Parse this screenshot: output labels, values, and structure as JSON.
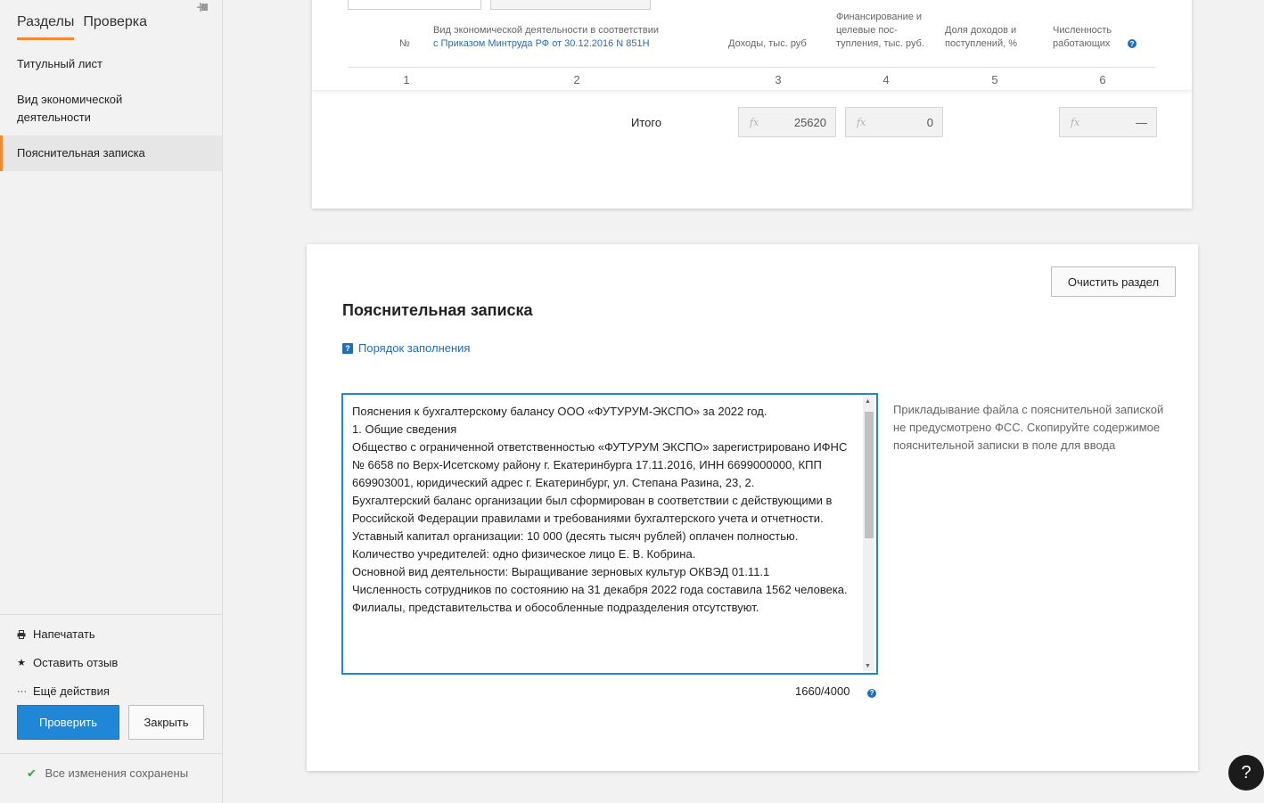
{
  "sidebar": {
    "tabs": [
      {
        "label": "Разделы"
      },
      {
        "label": "Проверка"
      }
    ],
    "items": [
      {
        "label": "Титульный лист"
      },
      {
        "label": "Вид экономической деятельности"
      },
      {
        "label": "Пояснительная записка"
      }
    ],
    "actions": [
      {
        "label": "Напечатать",
        "icon": "printer-icon"
      },
      {
        "label": "Оставить отзыв",
        "icon": "star-icon"
      },
      {
        "label": "Ещё действия",
        "icon": "ellipsis-icon"
      }
    ],
    "check_button": "Проверить",
    "close_button": "Закрыть",
    "saved_status": "Все изменения сохранены"
  },
  "table": {
    "headers": {
      "num": "№",
      "activity_prefix": "Вид экономической деятельности в соответствии",
      "activity_link": "с Приказом Минтруда РФ от 30.12.2016 N 851Н",
      "income": "Доходы, тыс. руб",
      "financing": "Финансирование и целевые пос-тупления, тыс. руб.",
      "share": "Доля доходов и поступлений, %",
      "employees": "Численность работающих"
    },
    "column_numbers": [
      "1",
      "2",
      "3",
      "4",
      "5",
      "6"
    ],
    "total_label": "Итого",
    "totals": {
      "income": "25620",
      "financing": "0",
      "employees": "—"
    },
    "fx_symbol": "fx"
  },
  "note_section": {
    "clear_button": "Очистить раздел",
    "title": "Пояснительная записка",
    "help_link": "Порядок заполнения",
    "text": "Пояснения к бухгалтерскому балансу ООО «ФУТУРУМ-ЭКСПО» за 2022 год.\n1. Общие сведения\nОбщество с ограниченной ответственностью «ФУТУРУМ ЭКСПО» зарегистрировано ИФНС № 6658 по Верх-Исетскому району г. Екатеринбурга 17.11.2016, ИНН 6699000000, КПП 669903001, юридический адрес г. Екатеринбург, ул. Степана Разина, 23, 2.\nБухгалтерский баланс организации был сформирован в соответствии с действующими в Российской Федерации правилами и требованиями бухгалтерского учета и отчетности.\nУставный капитал организации: 10 000 (десять тысяч рублей) оплачен полностью.\nКоличество учредителей: одно физическое лицо Е. В. Кобрина.\nОсновной вид деятельности: Выращивание зерновых культур ОКВЭД 01.11.1\nЧисленность сотрудников по состоянию на 31 декабря 2022 года составила 1562 человека.\nФилиалы, представительства и обособленные подразделения отсутствуют.",
    "side_note": "Прикладывание файла с пояснительной запиской не предусмотрено ФСС. Скопируйте содержимое пояснительной записки в поле для ввода",
    "counter": "1660/4000"
  },
  "help_bubble": "?",
  "colors": {
    "accent": "#f08a30",
    "primary": "#1f87d6",
    "link": "#1f6fb5"
  }
}
